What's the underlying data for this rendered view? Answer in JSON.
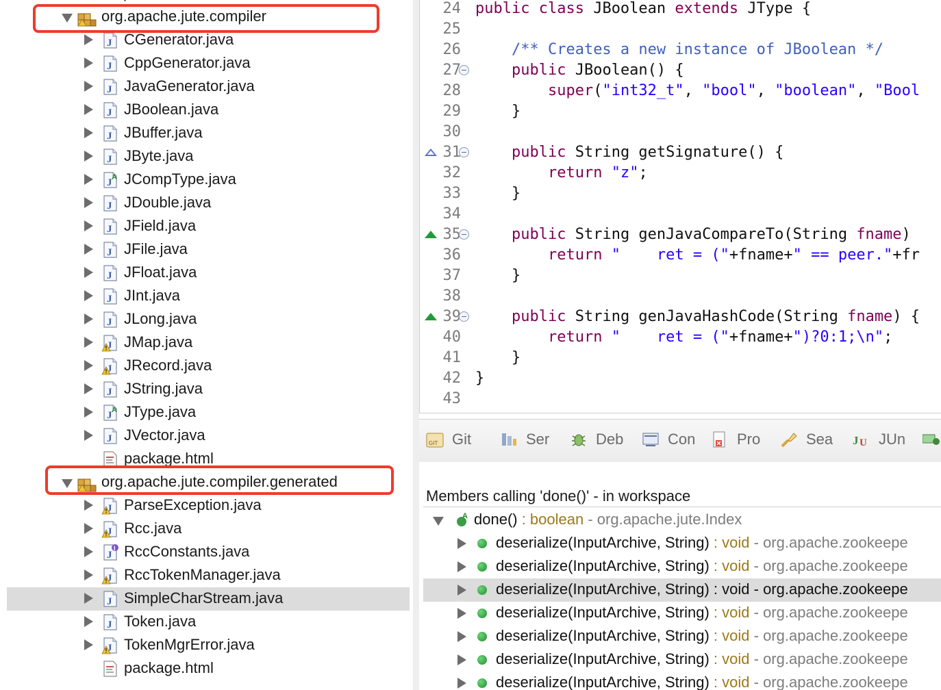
{
  "explorer": {
    "rows": [
      {
        "label": "org.apache.jute.compiler",
        "type": "package",
        "expanded": true
      },
      {
        "label": "CGenerator.java",
        "type": "java"
      },
      {
        "label": "CppGenerator.java",
        "type": "java"
      },
      {
        "label": "JavaGenerator.java",
        "type": "java"
      },
      {
        "label": "JBoolean.java",
        "type": "java"
      },
      {
        "label": "JBuffer.java",
        "type": "java"
      },
      {
        "label": "JByte.java",
        "type": "java"
      },
      {
        "label": "JCompType.java",
        "type": "java-abstract"
      },
      {
        "label": "JDouble.java",
        "type": "java"
      },
      {
        "label": "JField.java",
        "type": "java"
      },
      {
        "label": "JFile.java",
        "type": "java"
      },
      {
        "label": "JFloat.java",
        "type": "java"
      },
      {
        "label": "JInt.java",
        "type": "java"
      },
      {
        "label": "JLong.java",
        "type": "java"
      },
      {
        "label": "JMap.java",
        "type": "java-warn"
      },
      {
        "label": "JRecord.java",
        "type": "java-warn"
      },
      {
        "label": "JString.java",
        "type": "java"
      },
      {
        "label": "JType.java",
        "type": "java-abstract"
      },
      {
        "label": "JVector.java",
        "type": "java"
      },
      {
        "label": "package.html",
        "type": "html"
      },
      {
        "label": "org.apache.jute.compiler.generated",
        "type": "package",
        "expanded": true
      },
      {
        "label": "ParseException.java",
        "type": "java-warn"
      },
      {
        "label": "Rcc.java",
        "type": "java-warn"
      },
      {
        "label": "RccConstants.java",
        "type": "java-interface"
      },
      {
        "label": "RccTokenManager.java",
        "type": "java-warn"
      },
      {
        "label": "SimpleCharStream.java",
        "type": "java",
        "selected": true
      },
      {
        "label": "Token.java",
        "type": "java"
      },
      {
        "label": "TokenMgrError.java",
        "type": "java-warn"
      },
      {
        "label": "package.html",
        "type": "html"
      }
    ]
  },
  "editor": {
    "lines": [
      {
        "n": "24",
        "html": "<span class='kw'>public class</span> JBoolean <span class='kw'>extends</span> JType {"
      },
      {
        "n": "25",
        "html": ""
      },
      {
        "n": "26",
        "html": "    <span class='cm'>/** Creates a new instance of JBoolean */</span>"
      },
      {
        "n": "27",
        "fold": true,
        "html": "    <span class='kw'>public</span> JBoolean() {"
      },
      {
        "n": "28",
        "html": "        <span class='kw'>super</span>(<span class='str'>\"int32_t\"</span>, <span class='str'>\"bool\"</span>, <span class='str'>\"boolean\"</span>, <span class='str'>\"Bool</span>"
      },
      {
        "n": "29",
        "html": "    }"
      },
      {
        "n": "30",
        "html": ""
      },
      {
        "n": "31",
        "fold": true,
        "marker": "override-out",
        "html": "    <span class='kw'>public</span> String getSignature() {"
      },
      {
        "n": "32",
        "html": "        <span class='kw'>return</span> <span class='str'>\"z\"</span>;"
      },
      {
        "n": "33",
        "html": "    }"
      },
      {
        "n": "34",
        "html": ""
      },
      {
        "n": "35",
        "fold": true,
        "marker": "override",
        "html": "    <span class='kw'>public</span> String genJavaCompareTo(String <span class='kw'>fname</span>)"
      },
      {
        "n": "36",
        "html": "        <span class='kw'>return</span> <span class='str'>\"    ret = (\"</span>+fname+<span class='str'>\" == peer.\"</span>+fr"
      },
      {
        "n": "37",
        "html": "    }"
      },
      {
        "n": "38",
        "html": ""
      },
      {
        "n": "39",
        "fold": true,
        "marker": "override",
        "html": "    <span class='kw'>public</span> String genJavaHashCode(String <span class='kw'>fname</span>) {"
      },
      {
        "n": "40",
        "html": "        <span class='kw'>return</span> <span class='str'>\"    ret = (\"</span>+fname+<span class='str'>\")?0:1;\\n\"</span>;"
      },
      {
        "n": "41",
        "html": "    }"
      },
      {
        "n": "42",
        "html": "}"
      },
      {
        "n": "43",
        "html": ""
      }
    ]
  },
  "bottom": {
    "tabs": [
      {
        "label": "Git",
        "icon": "git-icon"
      },
      {
        "label": "Ser",
        "icon": "servers-icon"
      },
      {
        "label": "Deb",
        "icon": "debug-icon"
      },
      {
        "label": "Con",
        "icon": "console-icon"
      },
      {
        "label": "Pro",
        "icon": "problems-icon"
      },
      {
        "label": "Sea",
        "icon": "search-icon"
      },
      {
        "label": "JUn",
        "icon": "junit-icon"
      }
    ],
    "header": "Members calling 'done()' - in workspace",
    "root": {
      "sig": "done()",
      "ret": " : boolean",
      "pkg": " - org.apache.jute.Index"
    },
    "callers": [
      {
        "sig": "deserialize(InputArchive, String)",
        "ret": " : void",
        "pkg": " - org.apache.zookeepe"
      },
      {
        "sig": "deserialize(InputArchive, String)",
        "ret": " : void",
        "pkg": " - org.apache.zookeepe"
      },
      {
        "sig": "deserialize(InputArchive, String)",
        "ret": " : void",
        "pkg": " - org.apache.zookeepe",
        "selected": true
      },
      {
        "sig": "deserialize(InputArchive, String)",
        "ret": " : void",
        "pkg": " - org.apache.zookeepe"
      },
      {
        "sig": "deserialize(InputArchive, String)",
        "ret": " : void",
        "pkg": " - org.apache.zookeepe"
      },
      {
        "sig": "deserialize(InputArchive, String)",
        "ret": " : void",
        "pkg": " - org.apache.zookeepe"
      },
      {
        "sig": "deserialize(InputArchive, String)",
        "ret": " : void",
        "pkg": " - org.apache.zookeepe"
      }
    ]
  },
  "colors": {
    "highlight": "#ee3b2b",
    "keyword": "#7f0055",
    "string": "#2a00ff",
    "comment": "#3f5fbf"
  }
}
